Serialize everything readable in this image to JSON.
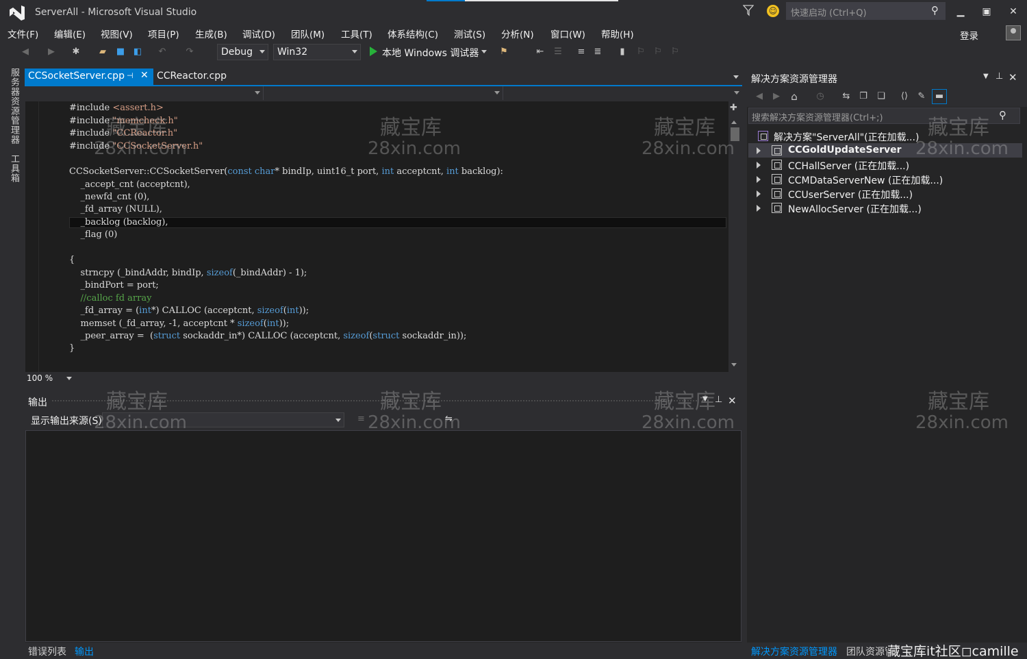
{
  "window": {
    "title": "ServerAll - Microsoft Visual Studio",
    "quick_launch_placeholder": "快速启动 (Ctrl+Q)",
    "sign_in": "登录"
  },
  "menu": [
    "文件(F)",
    "编辑(E)",
    "视图(V)",
    "项目(P)",
    "生成(B)",
    "调试(D)",
    "团队(M)",
    "工具(T)",
    "体系结构(C)",
    "测试(S)",
    "分析(N)",
    "窗口(W)",
    "帮助(H)"
  ],
  "toolbar": {
    "configuration": "Debug",
    "platform": "Win32",
    "run_label": "本地 Windows 调试器"
  },
  "left_strip": {
    "server_explorer": "服务器资源管理器",
    "toolbox": "工具箱"
  },
  "editor": {
    "tabs": [
      {
        "label": "CCSocketServer.cpp",
        "active": true
      },
      {
        "label": "CCReactor.cpp",
        "active": false
      }
    ],
    "zoom": "100 %"
  },
  "output": {
    "title": "输出",
    "source_label": "显示输出来源(S):",
    "bottom_tabs": [
      "错误列表",
      "输出"
    ]
  },
  "solution_explorer": {
    "title": "解决方案资源管理器",
    "search_placeholder": "搜索解决方案资源管理器(Ctrl+;)",
    "solution": "解决方案\"ServerAll\"(正在加载...)",
    "projects": [
      {
        "name": "CCGoldUpdateServer",
        "selected": true
      },
      {
        "name": "CCHallServer (正在加载...)",
        "selected": false
      },
      {
        "name": "CCMDataServerNew (正在加载...)",
        "selected": false
      },
      {
        "name": "CCUserServer (正在加载...)",
        "selected": false
      },
      {
        "name": "NewAllocServer (正在加载...)",
        "selected": false
      }
    ],
    "bottom_tabs": [
      "解决方案资源管理器",
      "团队资源管理器"
    ]
  },
  "watermark": {
    "line1": "藏宝库",
    "line2": "28xin.com"
  },
  "credit": "藏宝库it社区◻camille",
  "colors": {
    "accent": "#007acc",
    "background": "#2d2d30",
    "editor_bg": "#1e1e1e",
    "keyword": "#569cd6",
    "string": "#d69d85",
    "comment": "#57a64a",
    "run_green": "#27b13a"
  }
}
